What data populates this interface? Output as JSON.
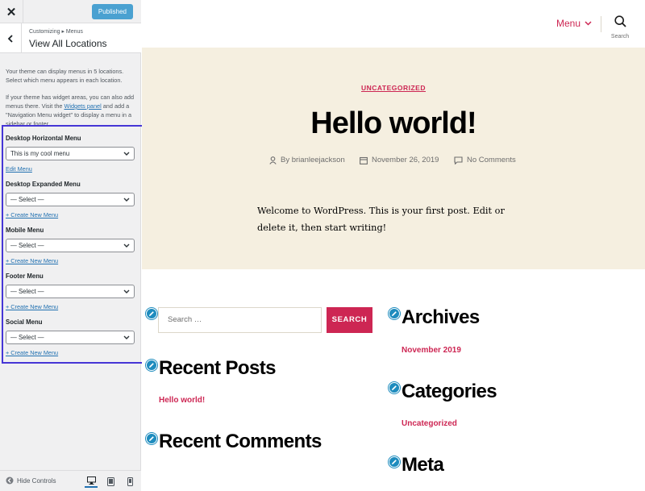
{
  "customizer": {
    "close_glyph": "✕",
    "publish_label": "Published",
    "breadcrumb": "Customizing ▸ Menus",
    "panel_title": "View All Locations",
    "desc1": "Your theme can display menus in 5 locations. Select which menu appears in each location.",
    "desc2_before": "If your theme has widget areas, you can also add menus there. Visit the ",
    "desc2_link": "Widgets panel",
    "desc2_after": " and add a \"Navigation Menu widget\" to display a menu in a sidebar or footer.",
    "locations": [
      {
        "label": "Desktop Horizontal Menu",
        "selected": "This is my cool menu",
        "link": "Edit Menu"
      },
      {
        "label": "Desktop Expanded Menu",
        "selected": "— Select —",
        "link": "+ Create New Menu"
      },
      {
        "label": "Mobile Menu",
        "selected": "— Select —",
        "link": "+ Create New Menu"
      },
      {
        "label": "Footer Menu",
        "selected": "— Select —",
        "link": "+ Create New Menu"
      },
      {
        "label": "Social Menu",
        "selected": "— Select —",
        "link": "+ Create New Menu"
      }
    ],
    "hide_controls_label": "Hide Controls"
  },
  "site": {
    "menu_label": "Menu",
    "search_label": "Search",
    "category": "UNCATEGORIZED",
    "post_title": "Hello world!",
    "author": "By brianleejackson",
    "date": "November 26, 2019",
    "comments": "No Comments",
    "content": "Welcome to WordPress. This is your first post. Edit or delete it, then start writing!",
    "search_placeholder": "Search …",
    "search_button": "SEARCH",
    "widgets": {
      "archives_title": "Archives",
      "archives_item": "November 2019",
      "recent_posts_title": "Recent Posts",
      "recent_posts_item": "Hello world!",
      "categories_title": "Categories",
      "categories_item": "Uncategorized",
      "recent_comments_title": "Recent Comments",
      "meta_title": "Meta"
    }
  },
  "colors": {
    "accent": "#cd2653",
    "hero_bg": "#f5efe0",
    "highlight_box": "#4636d6",
    "publish_btn": "#4aa1d1",
    "edit_shortcut": "#1e8cbe"
  }
}
